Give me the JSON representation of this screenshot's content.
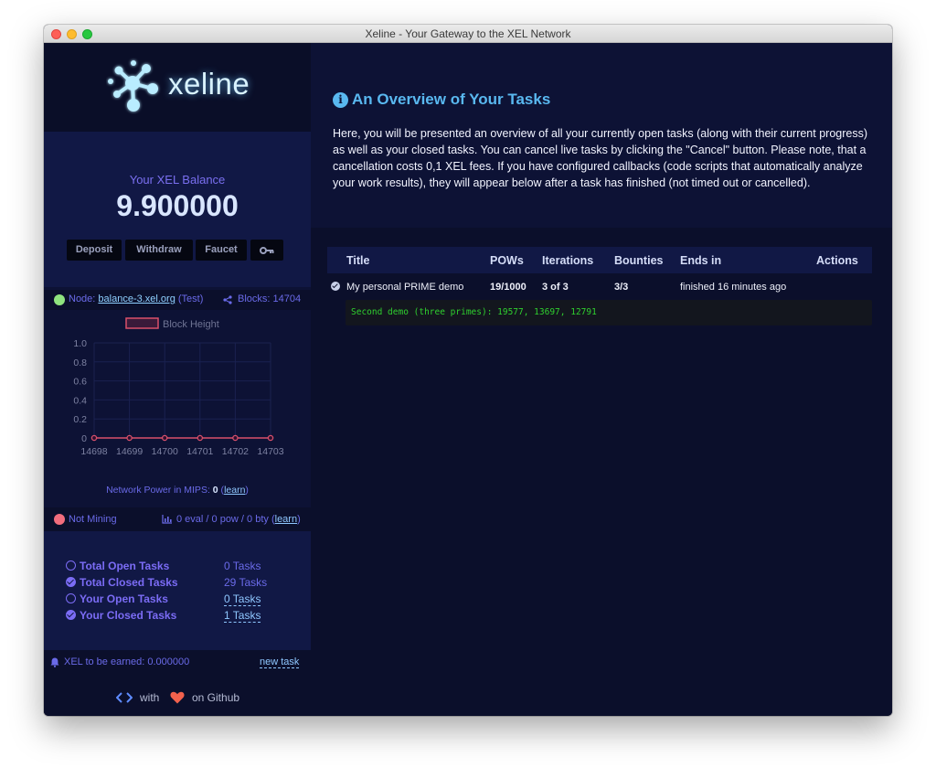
{
  "window": {
    "title": "Xeline - Your Gateway to the XEL Network"
  },
  "brand": {
    "name": "xeline"
  },
  "balance": {
    "label": "Your XEL Balance",
    "value": "9.900000",
    "buttons": [
      "Deposit",
      "Withdraw",
      "Faucet"
    ],
    "key_icon": "key-icon"
  },
  "node": {
    "prefix": "Node:",
    "host": "balance-3.xel.org",
    "suffix": "(Test)",
    "blocks_label": "Blocks: 14704",
    "status_color": "#8fe37e"
  },
  "chart_data": {
    "type": "line",
    "legend": "Block Height",
    "x": [
      "14698",
      "14699",
      "14700",
      "14701",
      "14702",
      "14703"
    ],
    "values": [
      0,
      0,
      0,
      0,
      0,
      0
    ],
    "ylim": [
      0,
      1.0
    ],
    "yticks": [
      "1.0",
      "0.8",
      "0.6",
      "0.4",
      "0.2",
      "0"
    ],
    "series_color": "#d9506b",
    "grid": true
  },
  "network_power": {
    "label": "Network Power in MIPS:",
    "value": "0",
    "link": "learn"
  },
  "mining": {
    "status": "Not Mining",
    "status_color": "#f26d7d",
    "stats": "0 eval / 0 pow / 0 bty",
    "link": "learn"
  },
  "task_summary": [
    {
      "label": "Total Open Tasks",
      "value": "0 Tasks",
      "icon": "open",
      "link": false
    },
    {
      "label": "Total Closed Tasks",
      "value": "29 Tasks",
      "icon": "closed",
      "link": false
    },
    {
      "label": "Your Open Tasks",
      "value": "0 Tasks",
      "icon": "open",
      "link": true
    },
    {
      "label": "Your Closed Tasks",
      "value": "1 Tasks",
      "icon": "closed",
      "link": true
    }
  ],
  "earn": {
    "label": "XEL to be earned: 0.000000",
    "new_task": "new task"
  },
  "footer": {
    "with": "with",
    "github": "on Github"
  },
  "main": {
    "heading": "An Overview of Your Tasks",
    "intro": "Here, you will be presented an overview of all your currently open tasks (along with their current progress) as well as your closed tasks. You can cancel live tasks by clicking the \"Cancel\" button. Please note, that a cancellation costs 0,1 XEL fees. If you have configured callbacks (code scripts that automatically analyze your work results), they will appear below after a task has finished (not timed out or cancelled).",
    "table": {
      "headers": [
        "Title",
        "POWs",
        "Iterations",
        "Bounties",
        "Ends in",
        "Actions"
      ],
      "rows": [
        {
          "title": "My personal PRIME demo",
          "pows": "19/1000",
          "iterations": "3 of 3",
          "bounties": "3/3",
          "ends_in": "finished 16 minutes ago"
        }
      ],
      "callback_output": "Second demo (three primes): 19577, 13697, 12791"
    }
  }
}
